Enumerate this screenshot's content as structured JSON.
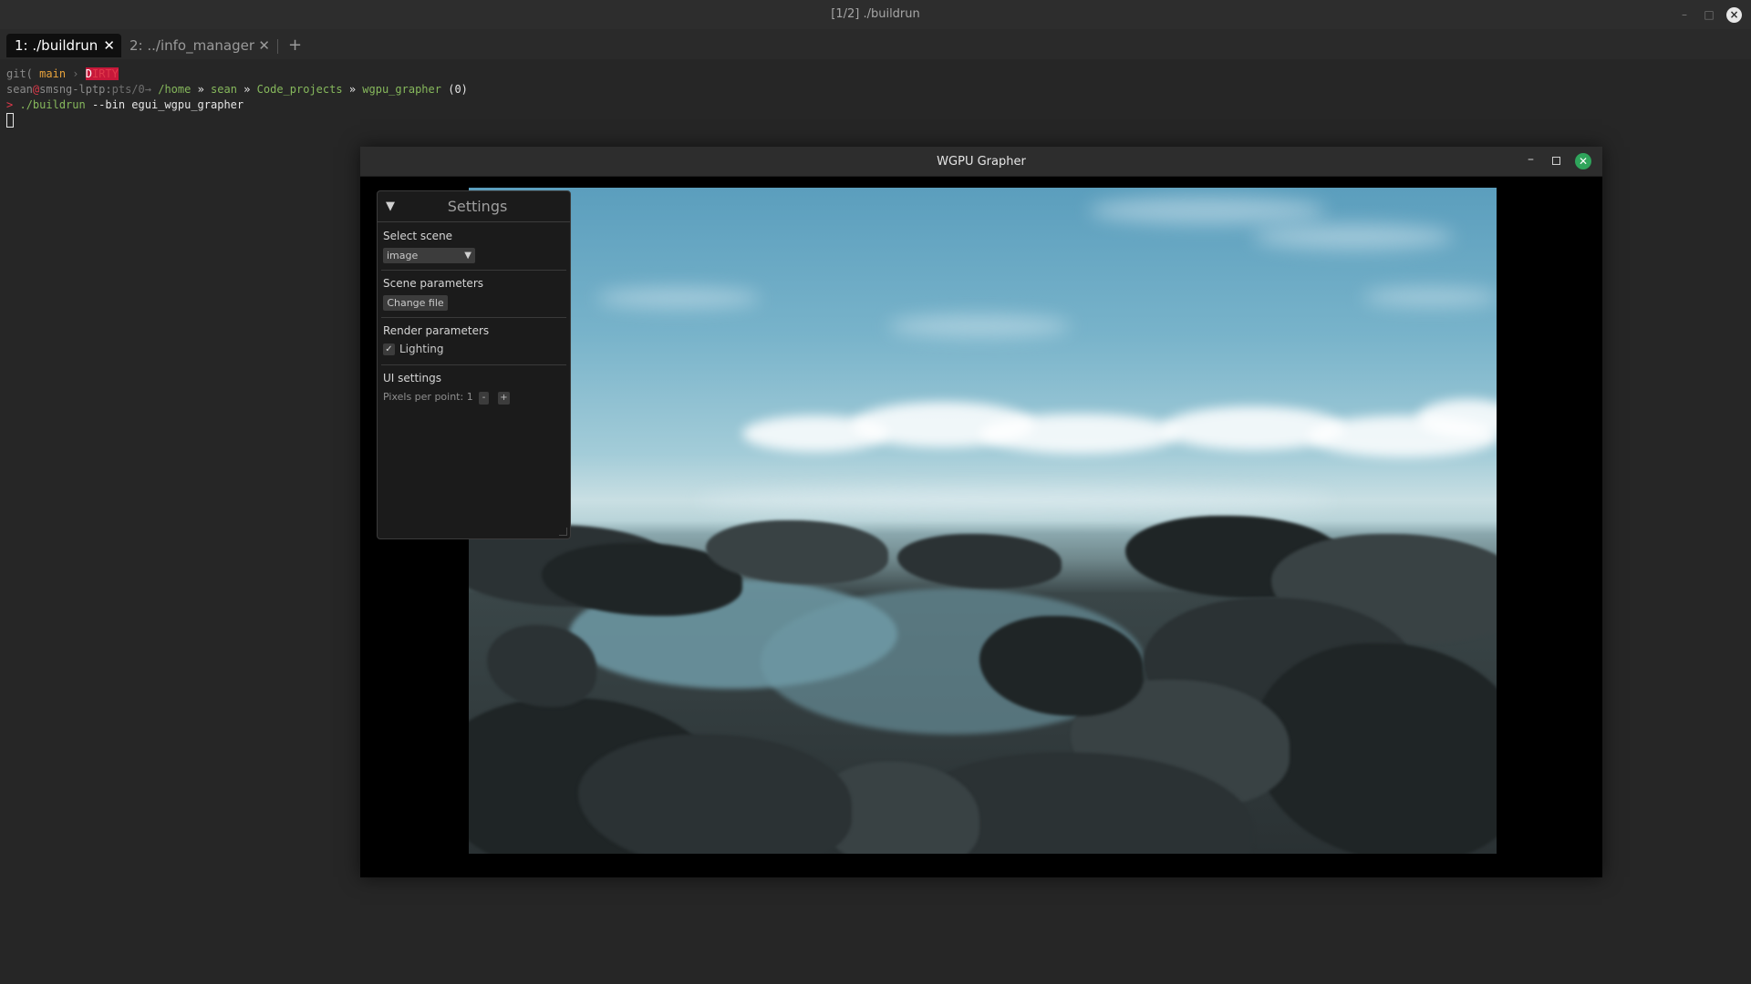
{
  "terminal": {
    "title": "[1/2] ./buildrun",
    "tabs": [
      {
        "label": "1: ./buildrun",
        "close": "✕"
      },
      {
        "label": "2: ../info_manager",
        "close": "✕"
      }
    ],
    "add_tab": "+",
    "prompt": {
      "git_prefix": "git(",
      "branch": "main",
      "arrow": "›",
      "dirty_first": "D",
      "dirty_rest": "IRTY",
      "user": "sean",
      "at": "@",
      "host": "smsng-lptp:",
      "pts": "pts/0",
      "pts_arrow": "→",
      "path_home": "/home",
      "sep": "»",
      "path_user": "sean",
      "path_projects": "Code_projects",
      "path_repo": "wgpu_grapher",
      "exit_code": "(0)",
      "marker": ">",
      "command": "./buildrun",
      "args": "--bin egui_wgpu_grapher"
    }
  },
  "wgpu_window": {
    "title": "WGPU Grapher",
    "minimize": "–",
    "close": "✕"
  },
  "settings": {
    "toggle": "▼",
    "title": "Settings",
    "select_scene_label": "Select scene",
    "scene_value": "image",
    "scene_arrow": "▼",
    "scene_params_label": "Scene parameters",
    "change_file": "Change file",
    "render_params_label": "Render parameters",
    "lighting_check": "✓",
    "lighting_label": "Lighting",
    "lighting_checked": true,
    "ui_settings_label": "UI settings",
    "pixels_per_point_label": "Pixels per point: 1",
    "ppp_minus": "-",
    "ppp_plus": "+"
  },
  "colors": {
    "branch": "#e8a33c",
    "dirty_badge": "#c7183a",
    "path": "#86b85c",
    "close_green": "#2fa45b"
  }
}
